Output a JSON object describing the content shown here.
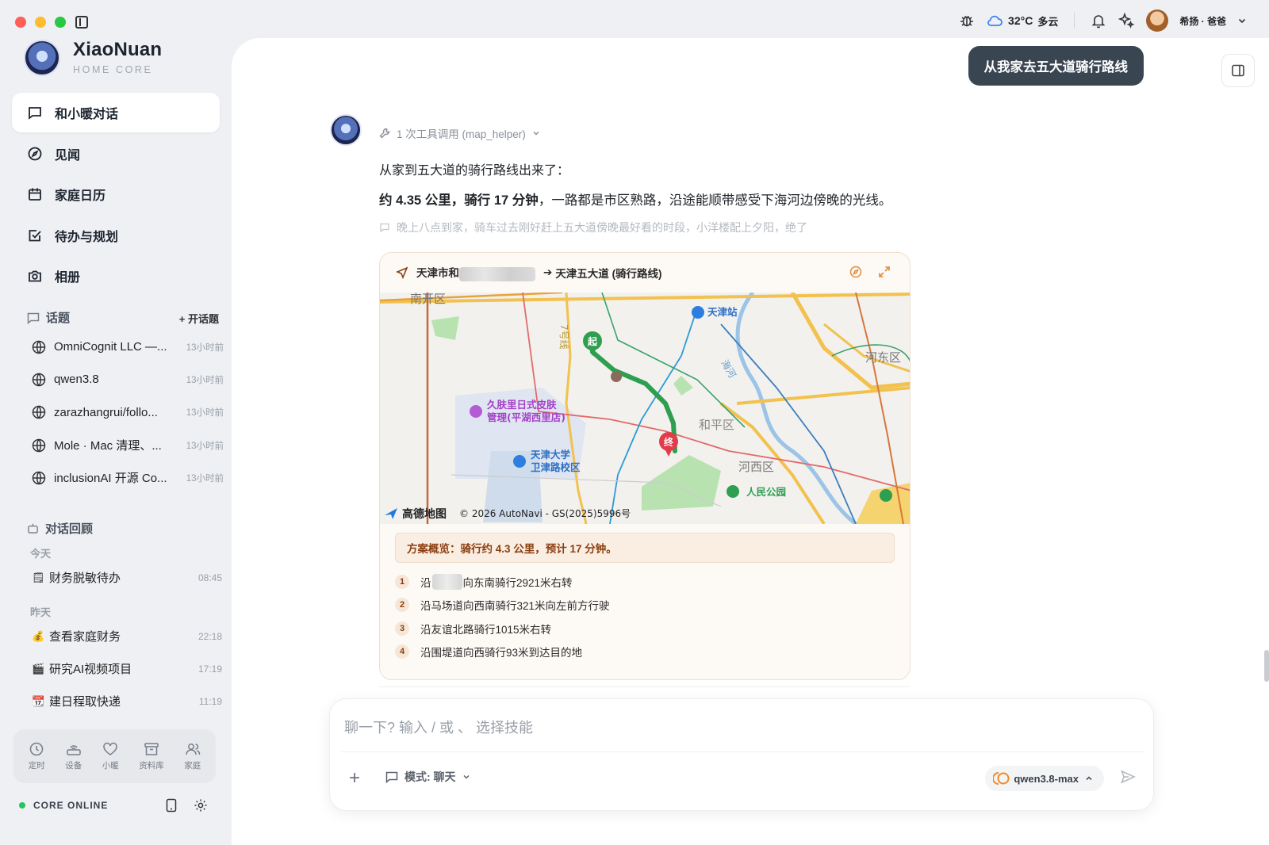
{
  "app": {
    "name": "XiaoNuan",
    "subtitle": "HOME CORE"
  },
  "topbar": {
    "temperature": "32°C",
    "condition": "多云",
    "user_label": "希扬 · 爸爸"
  },
  "nav": [
    {
      "label": "和小暖对话",
      "icon": "chat-icon",
      "active": true
    },
    {
      "label": "见闻",
      "icon": "compass-icon"
    },
    {
      "label": "家庭日历",
      "icon": "calendar-icon"
    },
    {
      "label": "待办与规划",
      "icon": "checkbox-icon"
    },
    {
      "label": "相册",
      "icon": "camera-icon"
    }
  ],
  "topics": {
    "header": "话题",
    "action": "+ 开话题",
    "items": [
      {
        "title": "OmniCognit LLC —...",
        "time": "13小时前"
      },
      {
        "title": "qwen3.8",
        "time": "13小时前"
      },
      {
        "title": "zarazhangrui/follo...",
        "time": "13小时前"
      },
      {
        "title": "Mole · Mac 清理、...",
        "time": "13小时前"
      },
      {
        "title": "inclusionAI 开源 Co...",
        "time": "13小时前"
      }
    ]
  },
  "history": {
    "header": "对话回顾",
    "today_label": "今天",
    "yesterday_label": "昨天",
    "today": [
      {
        "emoji": "🗒",
        "title": "财务脱敏待办",
        "time": "08:45"
      }
    ],
    "yesterday": [
      {
        "emoji": "💰",
        "title": "查看家庭财务",
        "time": "22:18"
      },
      {
        "emoji": "🎬",
        "title": "研究AI视频项目",
        "time": "17:19"
      },
      {
        "emoji": "📆",
        "title": "建日程取快递",
        "time": "11:19"
      }
    ]
  },
  "dock": [
    {
      "label": "定时",
      "icon": "clock-icon"
    },
    {
      "label": "设备",
      "icon": "router-icon"
    },
    {
      "label": "小暖",
      "icon": "heart-icon"
    },
    {
      "label": "资料库",
      "icon": "archive-icon"
    },
    {
      "label": "家庭",
      "icon": "family-icon"
    }
  ],
  "status": {
    "label": "CORE ONLINE"
  },
  "chat": {
    "user_message": "从我家去五大道骑行路线",
    "tool_call": "1 次工具调用 (map_helper)",
    "line1": "从家到五大道的骑行路线出来了：",
    "line2_bold": "约 4.35 公里，骑行 17 分钟",
    "line2_rest": "，一路都是市区熟路，沿途能顺带感受下海河边傍晚的光线。",
    "thought": "晚上八点到家，骑车过去刚好赶上五大道傍晚最好看的时段，小洋楼配上夕阳，绝了"
  },
  "map_card": {
    "from_prefix": "天津市和",
    "arrow": "➔",
    "to": "天津五大道 (骑行路线)",
    "map_labels": {
      "nankai": "南开区",
      "station": "天津站",
      "hedong": "河东区",
      "heping": "和平区",
      "hexi": "河西区",
      "park": "人民公园",
      "shop_line1": "久肤里日式皮肤",
      "shop_line2": "管理(平湖西里店)",
      "univ_line1": "天津大学",
      "univ_line2": "卫津路校区",
      "line7": "7号线",
      "road": "海河",
      "start": "起",
      "end": "终",
      "brand": "高德地图",
      "copyright": "© 2026 AutoNavi - GS(2025)5996号"
    },
    "overview": "方案概览：骑行约 4.3 公里，预计 17 分钟。",
    "steps": [
      {
        "n": "1",
        "pre": "沿",
        "text": "向东南骑行2921米右转"
      },
      {
        "n": "2",
        "pre": "",
        "text": "沿马场道向西南骑行321米向左前方行驶"
      },
      {
        "n": "3",
        "pre": "",
        "text": "沿友谊北路骑行1015米右转"
      },
      {
        "n": "4",
        "pre": "",
        "text": "沿围堤道向西骑行93米到达目的地"
      }
    ]
  },
  "composer": {
    "placeholder": "聊一下? 输入 / 或 、 选择技能",
    "mode": "模式: 聊天",
    "model": "qwen3.8-max"
  },
  "colors": {
    "accent": "#8b3e0f",
    "route": "#2e9e4f",
    "status_online": "#22c55e",
    "user_bubble": "#3a4552"
  }
}
